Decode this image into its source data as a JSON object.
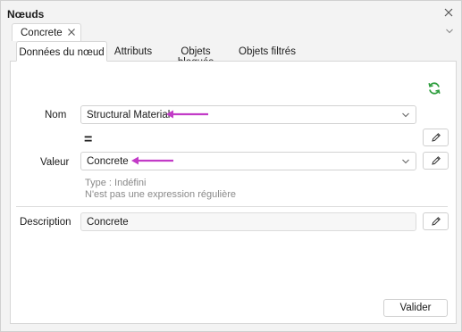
{
  "panel": {
    "title": "Nœuds"
  },
  "doc_tab": {
    "label": "Concrete"
  },
  "tabs": [
    {
      "label": "Données du nœud",
      "active": true
    },
    {
      "label": "Attributs",
      "active": false
    },
    {
      "label": "Objets bloqués",
      "active": false
    },
    {
      "label": "Objets filtrés",
      "active": false
    }
  ],
  "form": {
    "name_label": "Nom",
    "name_value": "Structural Material",
    "operator": "=",
    "value_label": "Valeur",
    "value_value": "Concrete",
    "type_hint": "Type : Indéfini",
    "regex_hint": "N'est pas une expression régulière",
    "description_label": "Description",
    "description_value": "Concrete"
  },
  "actions": {
    "validate_label": "Valider"
  },
  "colors": {
    "accent_arrow": "#c23bc7",
    "refresh": "#2e9e3e"
  },
  "icons": [
    "close-icon",
    "chevron-down-icon",
    "refresh-icon",
    "pencil-icon",
    "arrow-left-icon"
  ]
}
